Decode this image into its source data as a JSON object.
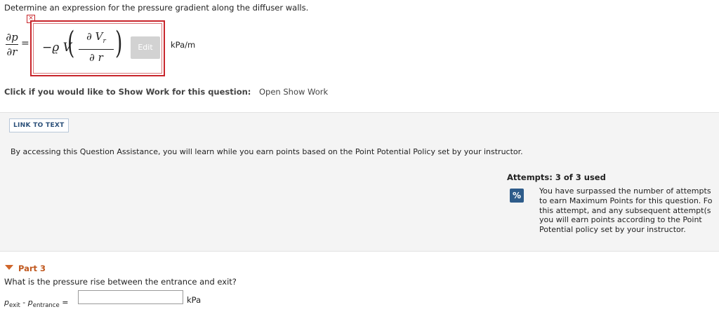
{
  "question": {
    "text": "Determine an expression for the pressure gradient along the diffuser walls."
  },
  "equation": {
    "lhs_numerator": "∂p",
    "lhs_denominator": "∂r",
    "equals": "=",
    "close_glyph": "×",
    "rhs_coefficient": "−ϱ V",
    "rhs_numerator": "∂ V",
    "rhs_numerator_sub": "r",
    "rhs_denominator": "∂ r",
    "paren_left": "(",
    "paren_right": ")",
    "edit_label": "Edit",
    "unit": "kPa/m"
  },
  "show_work": {
    "label": "Click if you would like to Show Work for this question:",
    "link": "Open Show Work"
  },
  "assistance": {
    "link_text_label": "LINK TO TEXT",
    "message": "By accessing this Question Assistance, you will learn while you earn points based on the Point Potential Policy set by your instructor."
  },
  "attempts": {
    "title": "Attempts: 3 of 3 used",
    "icon_glyph": "%",
    "icon": "percent-icon",
    "message_lines": [
      "You have surpassed the number of attempts",
      "to earn Maximum Points for this question. Fo",
      "this attempt, and any subsequent attempt(s",
      "you will earn points according to the Point",
      "Potential policy set by your instructor."
    ]
  },
  "part3": {
    "title": "Part 3",
    "question": "What is the pressure rise between the entrance and exit?",
    "lhs_p1": "p",
    "lhs_sub1": "exit",
    "lhs_minus": " - ",
    "lhs_p2": "p",
    "lhs_sub2": "entrance",
    "lhs_equals": " =",
    "input_value": "",
    "unit": "kPa"
  },
  "colors": {
    "error_border": "#c8252b",
    "part_accent": "#c0581e",
    "icon_blue": "#2e5c8a"
  }
}
